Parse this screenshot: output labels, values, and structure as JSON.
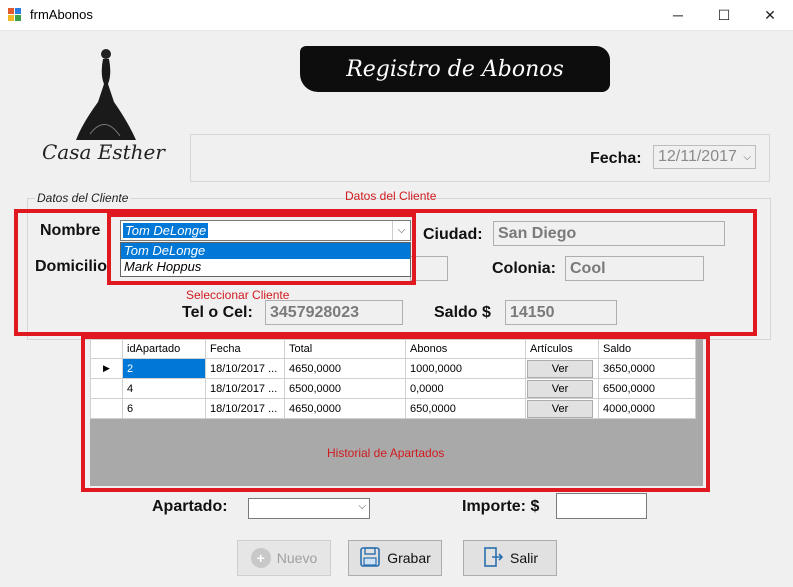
{
  "window": {
    "title": "frmAbonos",
    "minimize": "─",
    "maximize": "☐",
    "close": "✕"
  },
  "brand": {
    "name": "Casa Esther",
    "banner": "Registro de Abonos"
  },
  "header": {
    "fecha_label": "Fecha:",
    "fecha_value": "12/11/2017"
  },
  "cliente": {
    "group_label": "Datos del Cliente",
    "annotation_top": "Datos del Cliente",
    "annotation_select": "Seleccionar Cliente",
    "nombre_label": "Nombre",
    "nombre_selected": "Tom DeLonge",
    "dropdown_options": [
      "Tom DeLonge",
      "Mark Hoppus"
    ],
    "domicilio_label": "Domicilio",
    "ciudad_label": "Ciudad:",
    "ciudad_value": "San Diego",
    "colonia_label": "Colonia:",
    "colonia_value": "Cool",
    "tel_label": "Tel o Cel:",
    "tel_value": "3457928023",
    "saldo_label": "Saldo $",
    "saldo_value": "14150"
  },
  "historial": {
    "annotation": "Historial de Apartados",
    "columns": [
      "idApartado",
      "Fecha",
      "Total",
      "Abonos",
      "Artículos",
      "Saldo"
    ],
    "rows": [
      {
        "id": "2",
        "fecha": "18/10/2017 ...",
        "total": "4650,0000",
        "abonos": "1000,0000",
        "articulos": "Ver",
        "saldo": "3650,0000"
      },
      {
        "id": "4",
        "fecha": "18/10/2017 ...",
        "total": "6500,0000",
        "abonos": "0,0000",
        "articulos": "Ver",
        "saldo": "6500,0000"
      },
      {
        "id": "6",
        "fecha": "18/10/2017 ...",
        "total": "4650,0000",
        "abonos": "650,0000",
        "articulos": "Ver",
        "saldo": "4000,0000"
      }
    ]
  },
  "footer": {
    "apartado_label": "Apartado:",
    "apartado_value": "",
    "importe_label": "Importe: $",
    "importe_value": "",
    "nuevo": "Nuevo",
    "grabar": "Grabar",
    "salir": "Salir"
  }
}
